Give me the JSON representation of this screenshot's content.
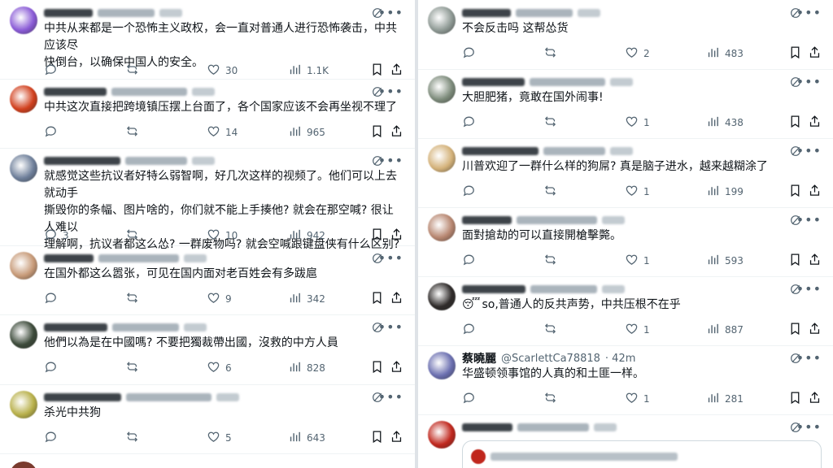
{
  "left": {
    "tweets": [
      {
        "name": "",
        "handle": "",
        "time": "",
        "text_lines": [
          "中共从来都是一个恐怖主义政权，会一直对普通人进行恐怖袭击，中共应该尽",
          "快倒台，以确保中国人的安全。"
        ],
        "replies": "",
        "retweets": "",
        "likes": "30",
        "views": "1.1K",
        "avatar": "#8a5bd6"
      },
      {
        "name": "",
        "handle": "",
        "time": "",
        "text_lines": [
          "中共这次直接把跨境镇压摆上台面了，各个国家应该不会再坐视不理了"
        ],
        "replies": "",
        "retweets": "",
        "likes": "14",
        "views": "965",
        "avatar": "#d1401e"
      },
      {
        "name": "",
        "handle": "",
        "time": "",
        "text_lines": [
          "就感觉这些抗议者好特么弱智啊，好几次这样的视频了。他们可以上去就动手",
          "撕毁你的条幅、图片啥的，你们就不能上手揍他? 就会在那空喊? 很让人难以",
          "理解啊，抗议者都这么怂? 一群废物吗? 就会空喊跟键盘侠有什么区别?"
        ],
        "replies": "3",
        "retweets": "",
        "likes": "10",
        "views": "942",
        "avatar": "#6e7f9a"
      },
      {
        "name": "",
        "handle": "",
        "time": "",
        "text_lines": [
          "在国外都这么嚣张，可见在国内面对老百姓会有多跋扈"
        ],
        "replies": "",
        "retweets": "",
        "likes": "9",
        "views": "342",
        "avatar": "#c79a78"
      },
      {
        "name": "",
        "handle": "",
        "time": "",
        "text_lines": [
          "他們以為是在中國嗎? 不要把獨裁帶出國，沒救的中方人員"
        ],
        "replies": "",
        "retweets": "",
        "likes": "6",
        "views": "828",
        "avatar": "#3c4a3a"
      },
      {
        "name": "",
        "handle": "",
        "time": "",
        "text_lines": [
          "杀光中共狗"
        ],
        "replies": "",
        "retweets": "",
        "likes": "5",
        "views": "643",
        "avatar": "#b8b04a"
      }
    ]
  },
  "right": {
    "tweets": [
      {
        "name": "",
        "handle": "",
        "time": "",
        "text_lines": [
          "不会反击吗 这帮怂货"
        ],
        "replies": "",
        "retweets": "",
        "likes": "2",
        "views": "483",
        "avatar": "#8f9a95"
      },
      {
        "name": "",
        "handle": "",
        "time": "",
        "text_lines": [
          "大胆肥猪，竟敢在国外闹事!"
        ],
        "replies": "",
        "retweets": "",
        "likes": "1",
        "views": "438",
        "avatar": "#7e8c7c"
      },
      {
        "name": "",
        "handle": "",
        "time": "",
        "text_lines": [
          "川普欢迎了一群什么样的狗屌? 真是脑子进水，越来越糊涂了"
        ],
        "replies": "",
        "retweets": "",
        "likes": "1",
        "views": "199",
        "avatar": "#d4b27a"
      },
      {
        "name": "",
        "handle": "",
        "time": "",
        "text_lines": [
          "面對搶劫的可以直接開槍擊斃。"
        ],
        "replies": "",
        "retweets": "",
        "likes": "1",
        "views": "593",
        "avatar": "#b78670"
      },
      {
        "name": "",
        "handle": "",
        "time": "",
        "emoji": "😴",
        "text_lines": [
          "so,普通人的反共声势，中共压根不在乎"
        ],
        "replies": "",
        "retweets": "",
        "likes": "1",
        "views": "887",
        "avatar": "#2f2b2a"
      },
      {
        "name": "蔡曉麗",
        "handle": "@ScarlettCa78818",
        "time": "· 42m",
        "text_lines": [
          "华盛顿领事馆的人真的和土匪一样。"
        ],
        "replies": "",
        "retweets": "",
        "likes": "1",
        "views": "281",
        "avatar": "#6b6fb0"
      },
      {
        "name": "",
        "handle": "",
        "time": "",
        "text_lines": [],
        "replies": "",
        "retweets": "",
        "likes": "",
        "views": "",
        "avatar": "#c0271d"
      }
    ]
  },
  "icons": [
    "grok-icon",
    "more-icon",
    "reply-icon",
    "retweet-icon",
    "like-icon",
    "views-icon",
    "bookmark-icon",
    "share-icon"
  ]
}
